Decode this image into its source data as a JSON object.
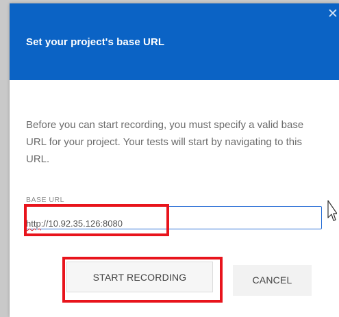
{
  "dialog": {
    "title": "Set your project's base URL",
    "close_icon": "close-icon",
    "description": "Before you can start recording, you must specify a valid base URL for your project. Your tests will start by navigating to this URL.",
    "base_url": {
      "label": "BASE URL",
      "value_scheme": "http",
      "value_rest": "://10.92.35.126:8080"
    },
    "buttons": {
      "start": "START RECORDING",
      "cancel": "CANCEL"
    }
  },
  "colors": {
    "header": "#0b63c5",
    "highlight": "#e8141c",
    "input_border": "#2a6fd6"
  }
}
